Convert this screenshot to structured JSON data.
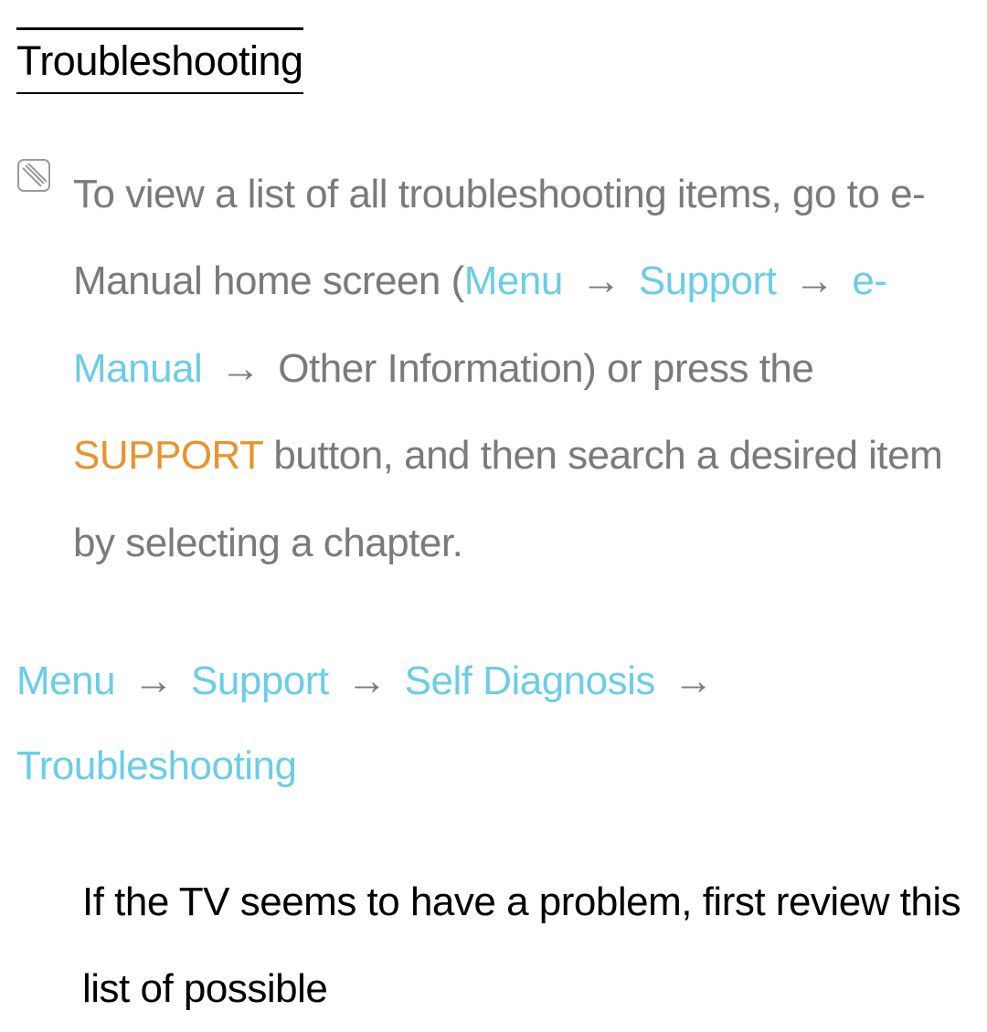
{
  "title": "Troubleshooting",
  "note": {
    "intro": "To view a list of all troubleshooting items, go to e-Manual home screen (",
    "menu": "Menu",
    "support": "Support",
    "emanual": "e-Manual",
    "afterEmanual": " Other Information) or press the ",
    "supportBtn": "SUPPORT",
    "afterSupport": " button, and then search a desired item by selecting a chapter."
  },
  "arrow": "→",
  "breadcrumb": {
    "menu": "Menu",
    "support": "Support",
    "selfDiagnosis": "Self Diagnosis",
    "troubleshooting": "Troubleshooting"
  },
  "body": "If the TV seems to have a problem, first review this list of possible"
}
